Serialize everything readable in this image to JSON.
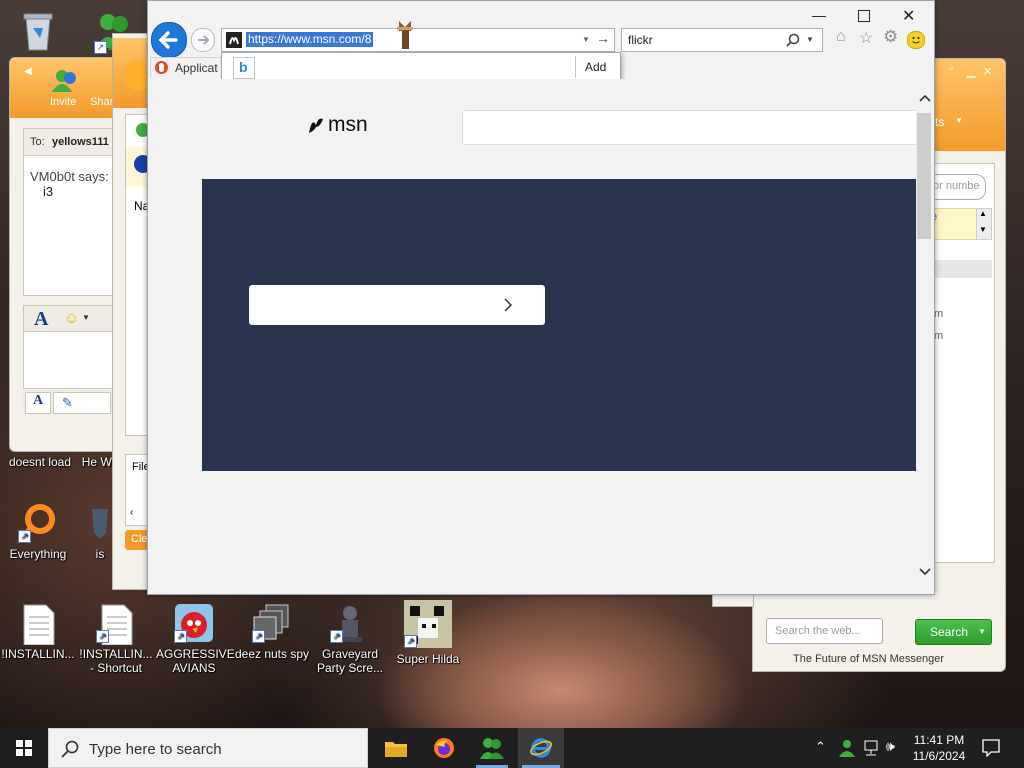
{
  "desktop": {
    "icons": [
      {
        "label": "doesnt load"
      },
      {
        "label": "He We"
      },
      {
        "label": "Everything"
      },
      {
        "label": "is"
      },
      {
        "label": "!INSTALLIN..."
      },
      {
        "label": "!INSTALLIN... - Shortcut"
      },
      {
        "label": "AGGRESSIVE AVIANS"
      },
      {
        "label": "deez nuts spy"
      },
      {
        "label": "Graveyard Party Scre..."
      },
      {
        "label": "Super Hilda"
      }
    ]
  },
  "messenger_left": {
    "toolbar": {
      "invite": "Invite",
      "share": "Shar"
    },
    "to_label": "To:",
    "to_value": "yellows111",
    "says": "VM0b0t says:",
    "message": "i3",
    "font_glyph": "A"
  },
  "messenger_middle": {
    "name_label": "Na",
    "file_label": "File",
    "clear_label": "Clea"
  },
  "messenger_right": {
    "header_text": "ts",
    "search_placeholder": "or numbe",
    "list_items": [
      "m",
      "m"
    ],
    "web_search_placeholder": "Search the web...",
    "search_button": "Search",
    "footer": "The Future of MSN Messenger"
  },
  "ie": {
    "url": "https://www.msn.com/8",
    "search_text": "flickr",
    "tab_label": "Applicat",
    "add_button": "Add",
    "page": {
      "logo_text": "msn"
    },
    "colors": {
      "banner": "#29344f",
      "back": "#1e76d6"
    }
  },
  "taskbar": {
    "search_placeholder": "Type here to search",
    "time": "11:41 PM",
    "date": "11/6/2024"
  }
}
